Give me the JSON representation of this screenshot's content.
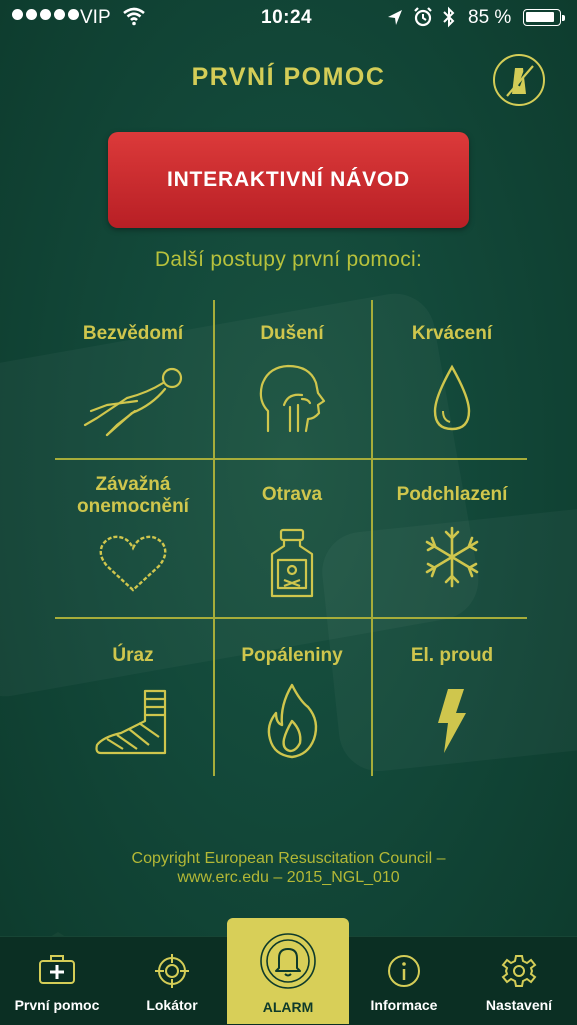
{
  "status_bar": {
    "carrier": "VIP",
    "time": "10:24",
    "battery_text": "85 %",
    "icons": [
      "signal-dots-icon",
      "wifi-icon",
      "location-icon",
      "alarm-clock-icon",
      "bluetooth-icon",
      "battery-icon"
    ]
  },
  "header": {
    "title": "PRVNÍ POMOC",
    "metronome_icon": "metronome-off-icon"
  },
  "cta": {
    "label": "INTERAKTIVNÍ NÁVOD"
  },
  "section_title": "Další postupy první pomoci:",
  "procedures": [
    {
      "label": "Bezvědomí",
      "icon": "unconscious-person-icon"
    },
    {
      "label": "Dušení",
      "icon": "choking-head-icon"
    },
    {
      "label": "Krvácení",
      "icon": "blood-drop-icon"
    },
    {
      "label": "Závažná onemocnění",
      "icon": "heart-icon"
    },
    {
      "label": "Otrava",
      "icon": "poison-bottle-icon"
    },
    {
      "label": "Podchlazení",
      "icon": "snowflake-icon"
    },
    {
      "label": "Úraz",
      "icon": "bandaged-foot-icon"
    },
    {
      "label": "Popáleniny",
      "icon": "flame-icon"
    },
    {
      "label": "El. proud",
      "icon": "lightning-icon"
    }
  ],
  "copyright": {
    "line1": "Copyright European Resuscitation Council –",
    "line2": "www.erc.edu – 2015_NGL_010"
  },
  "tabbar": {
    "tabs": [
      {
        "label": "První pomoc",
        "icon": "first-aid-kit-icon",
        "active": true
      },
      {
        "label": "Lokátor",
        "icon": "crosshair-icon",
        "active": false
      },
      {
        "label": "ALARM",
        "icon": "bell-icon",
        "active": false
      },
      {
        "label": "Informace",
        "icon": "info-icon",
        "active": false
      },
      {
        "label": "Nastavení",
        "icon": "gear-icon",
        "active": false
      }
    ]
  },
  "colors": {
    "background": "#0f4232",
    "accent": "#d4cd57",
    "cta": "#c9282e",
    "tabbar": "#0b2f23"
  }
}
